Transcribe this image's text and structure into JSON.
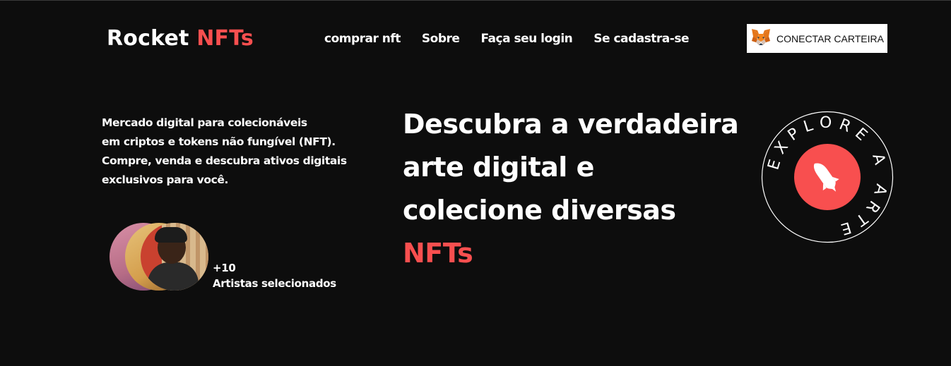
{
  "header": {
    "logo_main": "Rocket",
    "logo_accent": "NFTs",
    "nav": [
      "comprar nft",
      "Sobre",
      "Faça seu login",
      "Se cadastra-se"
    ],
    "wallet_button": "CONECTAR CARTEIRA"
  },
  "hero": {
    "tagline": [
      "Mercado digital para colecionáveis",
      "em criptos e tokens não fungível (NFT).",
      "Compre, venda e descubra ativos digitais",
      "exclusivos para você."
    ],
    "artists_count": "+10",
    "artists_label": "Artistas selecionados",
    "headline": [
      "Descubra a verdadeira",
      "arte digital e",
      "colecione diversas"
    ],
    "headline_accent": "NFTs",
    "badge_text": "EXPLORE A ARTE"
  },
  "colors": {
    "background": "#0d0d0d",
    "accent": "#f84f4f",
    "text": "#ffffff"
  },
  "icons": {
    "wallet": "metamask-fox-icon",
    "badge": "rocket-icon"
  }
}
